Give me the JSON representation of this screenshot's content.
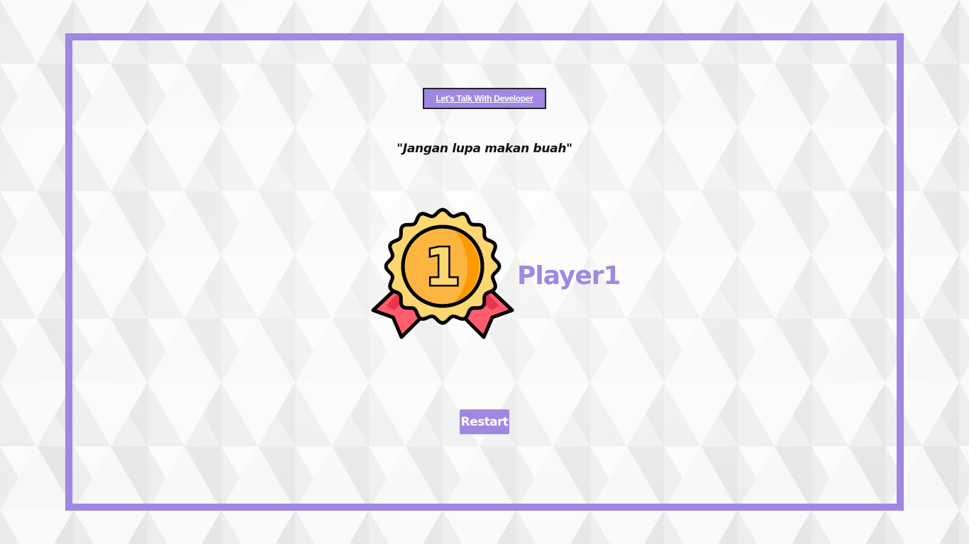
{
  "header": {
    "developer_button_label": "Let's Talk With Developer"
  },
  "message": {
    "quote": "\"Jangan lupa makan buah\""
  },
  "result": {
    "medal_icon": "first-place-medal-icon",
    "medal_number": "1",
    "winner_name": "Player1"
  },
  "controls": {
    "restart_label": "Restart"
  },
  "colors": {
    "accent": "#9f87e3",
    "medal_gold": "#fbb540",
    "medal_gold_light": "#fcd770",
    "medal_shade": "#fe9901",
    "ribbon_red": "#ff5d6c",
    "ribbon_dark": "#e8374a",
    "outline": "#000000"
  }
}
